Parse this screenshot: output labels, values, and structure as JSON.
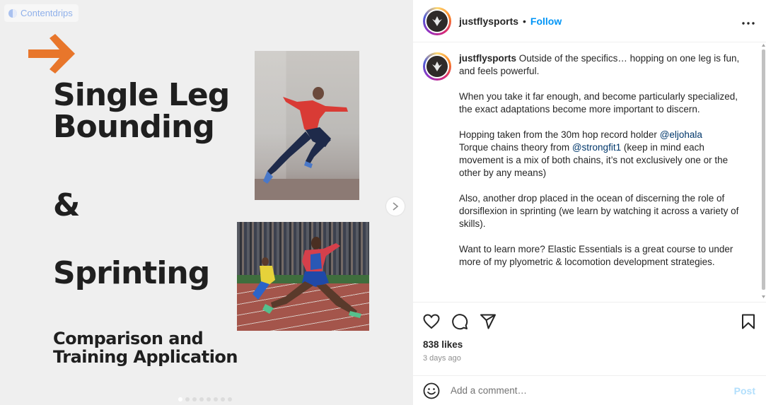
{
  "slide": {
    "watermark": "Contentdrips",
    "title_line1": "Single Leg",
    "title_line2": "Bounding",
    "ampersand": "&",
    "title_line3": "Sprinting",
    "subtitle_line1": "Comparison and",
    "subtitle_line2": "Training Application",
    "accent_color": "#e8762b",
    "arrow_icon": "arrow-right-icon",
    "next_icon": "chevron-right-icon",
    "pagination": {
      "total": 8,
      "active": 1
    }
  },
  "header": {
    "username": "justflysports",
    "separator": "•",
    "follow_label": "Follow",
    "more_icon": "more-horizontal-icon"
  },
  "caption": {
    "username": "justflysports",
    "p1": "Outside of the specifics… hopping on one leg is fun, and feels powerful.",
    "p2": "When you take it far enough, and become particularly specialized, the exact adaptations become more important to discern.",
    "p3a": "Hopping taken from the 30m hop record holder",
    "mention1": "@eljohala",
    "p3b": "Torque chains theory from",
    "mention2": "@strongfit1",
    "p3c": "(keep in mind each movement is a mix of both chains, it’s not exclusively one or the other by any means)",
    "p4": "Also, another drop placed in the ocean of discerning the role of dorsiflexion in sprinting (we learn by watching it across a variety of skills).",
    "p5": "Want to learn more? Elastic Essentials is a great course to under more of my plyometric & locomotion development strategies."
  },
  "actions": {
    "like_icon": "heart-icon",
    "comment_icon": "comment-icon",
    "share_icon": "send-icon",
    "save_icon": "bookmark-icon",
    "likes": "838 likes",
    "time": "3 days ago"
  },
  "comment": {
    "emoji_icon": "emoji-icon",
    "placeholder": "Add a comment…",
    "post_label": "Post"
  },
  "colors": {
    "link_blue": "#0095f6",
    "mention": "#00376b",
    "post_disabled": "#b2dffc"
  }
}
